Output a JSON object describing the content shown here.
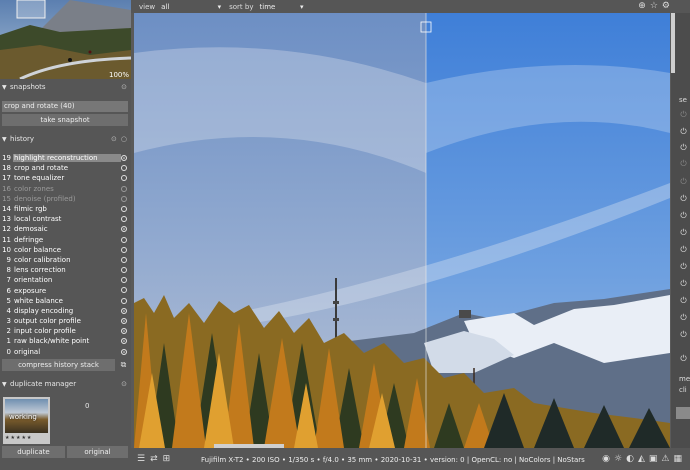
{
  "navigation": {
    "zoom": "100%"
  },
  "topbar": {
    "view_label": "view",
    "view_value": "all",
    "sort_label": "sort by",
    "sort_value": "time"
  },
  "snapshots": {
    "title": "snapshots",
    "current": "crop and rotate (40)",
    "take_button": "take snapshot"
  },
  "history": {
    "title": "history",
    "items": [
      {
        "num": "19",
        "label": "highlight reconstruction",
        "state": "on",
        "selected": true,
        "dim": false
      },
      {
        "num": "18",
        "label": "crop and rotate",
        "state": "off",
        "selected": false,
        "dim": false
      },
      {
        "num": "17",
        "label": "tone equalizer",
        "state": "off",
        "selected": false,
        "dim": false
      },
      {
        "num": "16",
        "label": "color zones",
        "state": "off",
        "selected": false,
        "dim": true
      },
      {
        "num": "15",
        "label": "denoise (profiled)",
        "state": "off",
        "selected": false,
        "dim": true
      },
      {
        "num": "14",
        "label": "filmic rgb",
        "state": "off",
        "selected": false,
        "dim": false
      },
      {
        "num": "13",
        "label": "local contrast",
        "state": "off",
        "selected": false,
        "dim": false
      },
      {
        "num": "12",
        "label": "demosaic",
        "state": "on",
        "selected": false,
        "dim": false
      },
      {
        "num": "11",
        "label": "defringe",
        "state": "off",
        "selected": false,
        "dim": false
      },
      {
        "num": "10",
        "label": "color balance",
        "state": "off",
        "selected": false,
        "dim": false
      },
      {
        "num": "9",
        "label": "color calibration",
        "state": "off",
        "selected": false,
        "dim": false
      },
      {
        "num": "8",
        "label": "lens correction",
        "state": "off",
        "selected": false,
        "dim": false
      },
      {
        "num": "7",
        "label": "orientation",
        "state": "off",
        "selected": false,
        "dim": false
      },
      {
        "num": "6",
        "label": "exposure",
        "state": "off",
        "selected": false,
        "dim": false
      },
      {
        "num": "5",
        "label": "white balance",
        "state": "off",
        "selected": false,
        "dim": false
      },
      {
        "num": "4",
        "label": "display encoding",
        "state": "on",
        "selected": false,
        "dim": false
      },
      {
        "num": "3",
        "label": "output color profile",
        "state": "on",
        "selected": false,
        "dim": false
      },
      {
        "num": "2",
        "label": "input color profile",
        "state": "on",
        "selected": false,
        "dim": false
      },
      {
        "num": "1",
        "label": "raw black/white point",
        "state": "on",
        "selected": false,
        "dim": false
      },
      {
        "num": "0",
        "label": "original",
        "state": "on",
        "selected": false,
        "dim": false
      }
    ],
    "compress_button": "compress history stack"
  },
  "duplicate_manager": {
    "title": "duplicate manager",
    "thumb_label": "working",
    "stars": "★★★★★",
    "count": "0",
    "duplicate_button": "duplicate",
    "original_button": "original"
  },
  "right_panel": {
    "label_1": "se",
    "label_2": "me",
    "label_3": "cli"
  },
  "statusbar": {
    "info": "Fujifilm X-T2 • 200 ISO • 1/350 s • f/4.0 • 35 mm • 2020-10-31 • version: 0 | OpenCL: no | NoColors | NoStars"
  }
}
